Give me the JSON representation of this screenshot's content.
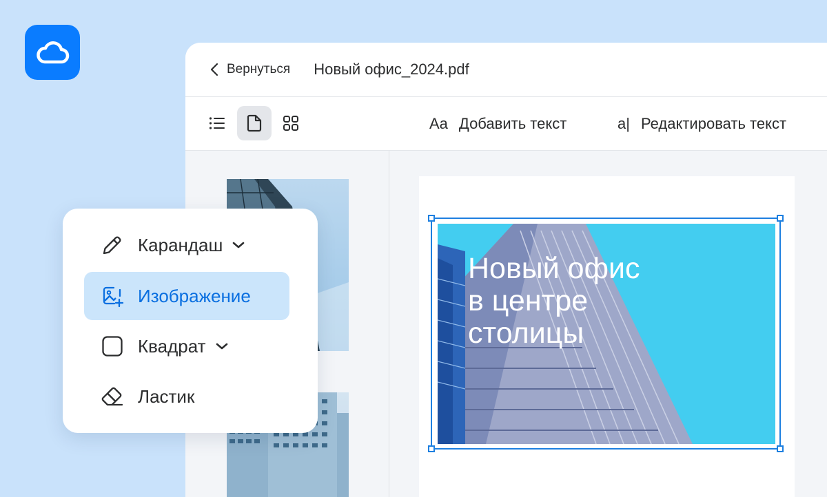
{
  "app": {
    "logo_icon": "cloud-icon",
    "brand_color": "#0a7cff"
  },
  "header": {
    "back_label": "Вернуться",
    "file_name": "Новый офис_2024.pdf"
  },
  "toolbar": {
    "views": [
      {
        "icon": "list-view-icon",
        "active": false
      },
      {
        "icon": "page-view-icon",
        "active": true
      },
      {
        "icon": "grid-view-icon",
        "active": false
      }
    ],
    "add_text_icon": "Aa",
    "add_text_label": "Добавить текст",
    "edit_text_icon": "a|",
    "edit_text_label": "Редактировать текст"
  },
  "document": {
    "headline_lines": [
      "Новый офис",
      "в центре",
      "столицы"
    ],
    "image_bg": "#43cdf0",
    "selection_color": "#1d7fe0"
  },
  "tools": [
    {
      "label": "Карандаш",
      "icon": "pencil-icon",
      "has_dropdown": true,
      "selected": false
    },
    {
      "label": "Изображение",
      "icon": "image-add-icon",
      "has_dropdown": false,
      "selected": true
    },
    {
      "label": "Квадрат",
      "icon": "square-icon",
      "has_dropdown": true,
      "selected": false
    },
    {
      "label": "Ластик",
      "icon": "eraser-icon",
      "has_dropdown": false,
      "selected": false
    }
  ]
}
